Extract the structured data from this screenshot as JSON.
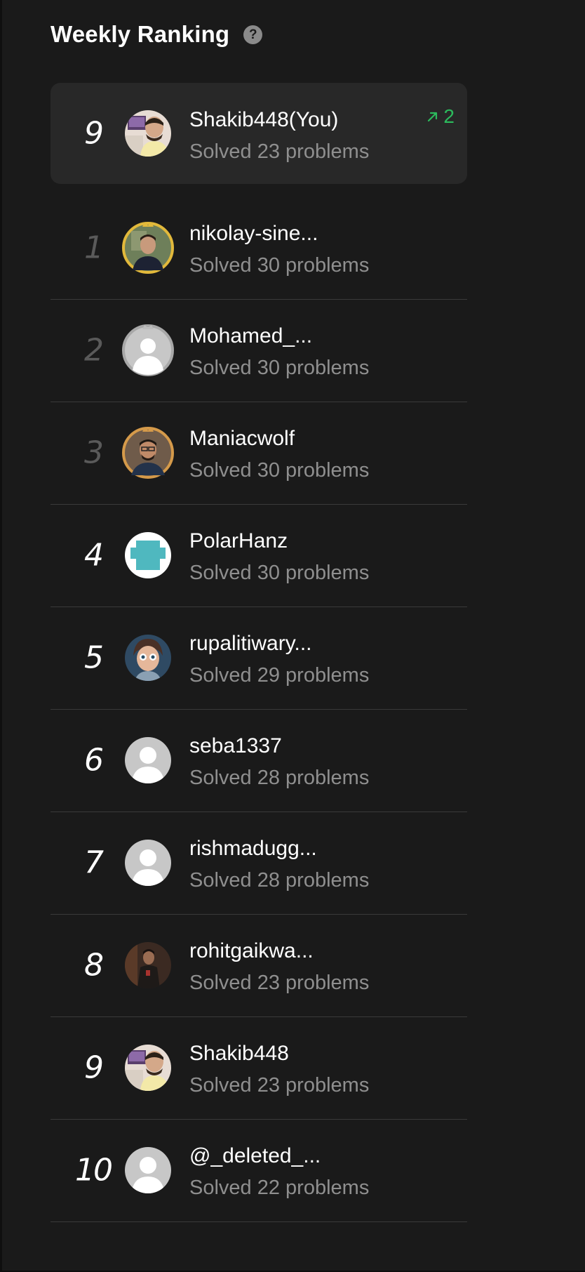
{
  "header": {
    "title": "Weekly Ranking",
    "help_glyph": "?"
  },
  "current_user": {
    "rank": "9",
    "name": "Shakib448(You)",
    "solved": "Solved 23 problems",
    "change": "2",
    "change_color": "#2cbb5d"
  },
  "ranking": [
    {
      "rank": "1",
      "name": "nikolay-sine...",
      "solved": "Solved 30 problems",
      "avatar": "photo-gold-crown"
    },
    {
      "rank": "2",
      "name": "Mohamed_...",
      "solved": "Solved 30 problems",
      "avatar": "default-silver-crown"
    },
    {
      "rank": "3",
      "name": "Maniacwolf",
      "solved": "Solved 30 problems",
      "avatar": "photo-bronze-crown"
    },
    {
      "rank": "4",
      "name": "PolarHanz",
      "solved": "Solved 30 problems",
      "avatar": "teal-pixel"
    },
    {
      "rank": "5",
      "name": "rupalitiwary...",
      "solved": "Solved 29 problems",
      "avatar": "cartoon-photo"
    },
    {
      "rank": "6",
      "name": "seba1337",
      "solved": "Solved 28 problems",
      "avatar": "default"
    },
    {
      "rank": "7",
      "name": "rishmadugg...",
      "solved": "Solved 28 problems",
      "avatar": "default"
    },
    {
      "rank": "8",
      "name": "rohitgaikwa...",
      "solved": "Solved 23 problems",
      "avatar": "photo-dark"
    },
    {
      "rank": "9",
      "name": "Shakib448",
      "solved": "Solved 23 problems",
      "avatar": "photo-light"
    },
    {
      "rank": "10",
      "name": "@_deleted_...",
      "solved": "Solved 22 problems",
      "avatar": "default"
    }
  ],
  "colors": {
    "background": "#1a1a1a",
    "card": "#282828",
    "divider": "#3a3a3a",
    "muted_text": "#8f8f8f",
    "gold": "#e2b93b",
    "silver": "#a8a8a8",
    "bronze": "#d59a4a",
    "green": "#2cbb5d"
  }
}
